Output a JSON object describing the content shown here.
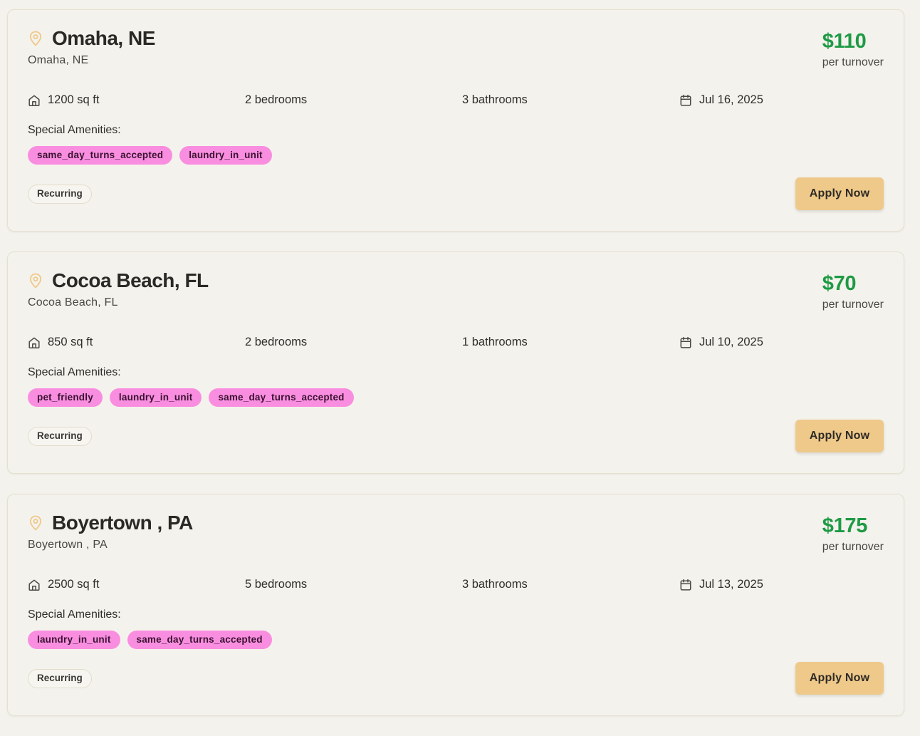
{
  "listings": [
    {
      "title": "Omaha, NE",
      "subtitle": "Omaha, NE",
      "price": "$110",
      "price_unit": "per turnover",
      "specs": [
        "1200 sq ft",
        "2 bedrooms",
        "3 bathrooms",
        "Jul 16, 2025"
      ],
      "amenities_label": "Special Amenities:",
      "amenities": [
        "same_day_turns_accepted",
        "laundry_in_unit"
      ],
      "badge": "Recurring",
      "apply_label": "Apply Now"
    },
    {
      "title": "Cocoa Beach, FL",
      "subtitle": "Cocoa Beach, FL",
      "price": "$70",
      "price_unit": "per turnover",
      "specs": [
        "850 sq ft",
        "2 bedrooms",
        "1 bathrooms",
        "Jul 10, 2025"
      ],
      "amenities_label": "Special Amenities:",
      "amenities": [
        "pet_friendly",
        "laundry_in_unit",
        "same_day_turns_accepted"
      ],
      "badge": "Recurring",
      "apply_label": "Apply Now"
    },
    {
      "title": "Boyertown , PA",
      "subtitle": "Boyertown , PA",
      "price": "$175",
      "price_unit": "per turnover",
      "specs": [
        "2500 sq ft",
        "5 bedrooms",
        "3 bathrooms",
        "Jul 13, 2025"
      ],
      "amenities_label": "Special Amenities:",
      "amenities": [
        "laundry_in_unit",
        "same_day_turns_accepted"
      ],
      "badge": "Recurring",
      "apply_label": "Apply Now"
    }
  ],
  "icons": {
    "location": "map-pin-icon",
    "area": "home-icon",
    "date": "calendar-icon"
  },
  "colors": {
    "price": "#1e9a45",
    "chip": "#f98ee0",
    "apply_button": "#efc98a",
    "pin": "#efc98a"
  }
}
